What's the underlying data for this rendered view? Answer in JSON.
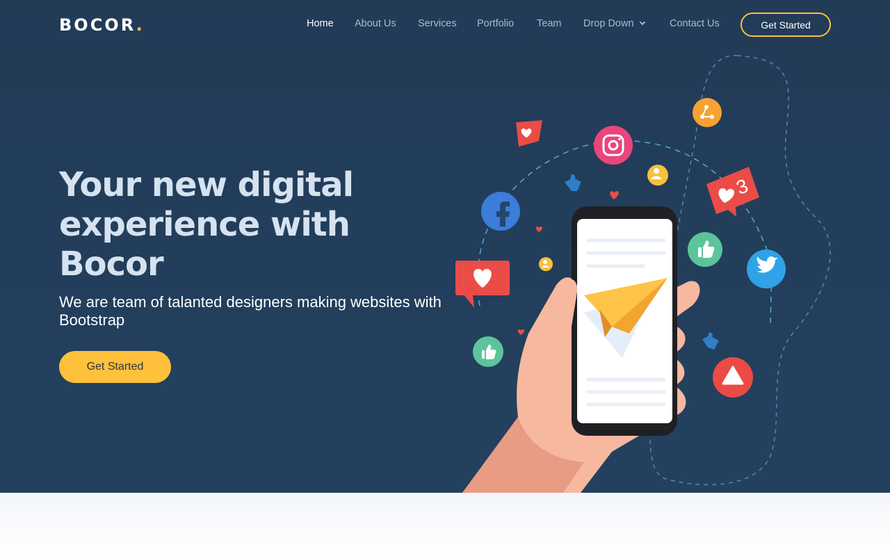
{
  "header": {
    "logo_text": "BOCOR",
    "logo_dot": ".",
    "nav": [
      {
        "label": "Home"
      },
      {
        "label": "About Us"
      },
      {
        "label": "Services"
      },
      {
        "label": "Portfolio"
      },
      {
        "label": "Team"
      },
      {
        "label": "Drop Down"
      },
      {
        "label": "Contact Us"
      }
    ],
    "cta_label": "Get Started"
  },
  "hero": {
    "title": "Your new digital experience with Bocor",
    "subtitle": "We are team of talanted designers making websites with Bootstrap",
    "cta_label": "Get Started",
    "illustration_badge_count": "3"
  },
  "colors": {
    "hero_bg": "#223b57",
    "accent": "#ffc13b",
    "nav_text": "#a8bbd0"
  }
}
